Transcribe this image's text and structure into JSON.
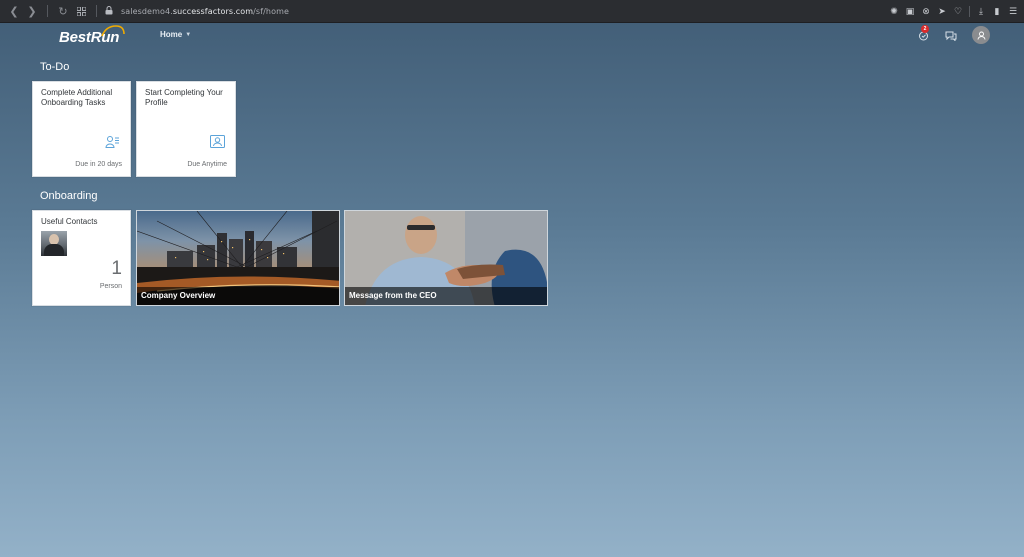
{
  "browser": {
    "url_prefix": "salesdemo4.",
    "url_domain": "successfactors.com",
    "url_path": "/sf/home"
  },
  "header": {
    "logo": "BestRun",
    "home_menu": "Home",
    "notification_count": "2"
  },
  "todo": {
    "title": "To-Do",
    "tiles": [
      {
        "title": "Complete Additional Onboarding Tasks",
        "footer": "Due in 20 days",
        "icon": "user-tasks-icon"
      },
      {
        "title": "Start Completing Your Profile",
        "footer": "Due Anytime",
        "icon": "profile-card-icon"
      }
    ]
  },
  "onboarding": {
    "title": "Onboarding",
    "contacts": {
      "title": "Useful Contacts",
      "count": "1",
      "unit": "Person"
    },
    "image_tiles": [
      {
        "caption": "Company Overview"
      },
      {
        "caption": "Message from the CEO"
      }
    ]
  },
  "colors": {
    "accent_icon": "#5ba3d9",
    "badge": "#d92b2b"
  }
}
